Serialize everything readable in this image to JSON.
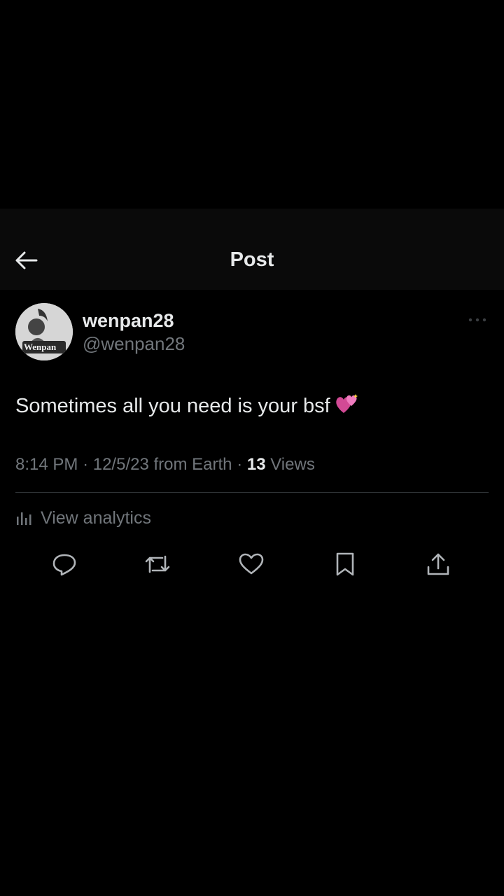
{
  "header": {
    "title": "Post",
    "back_icon": "arrow-left-icon"
  },
  "author": {
    "display_name": "wenpan28",
    "handle": "@wenpan28",
    "avatar_label": "Wenpan"
  },
  "post": {
    "text": "Sometimes all you need is your bsf",
    "emoji": "two-hearts-icon"
  },
  "meta": {
    "time": "8:14 PM",
    "date": "12/5/23",
    "source": "from Earth",
    "views_count": "13",
    "views_label": "Views"
  },
  "analytics": {
    "label": "View analytics"
  },
  "actions": [
    "reply-icon",
    "repost-icon",
    "like-icon",
    "bookmark-icon",
    "share-icon"
  ],
  "colors": {
    "background": "#000000",
    "text": "#e7e9ea",
    "secondary": "#71767b",
    "emoji": "#e0529c"
  }
}
